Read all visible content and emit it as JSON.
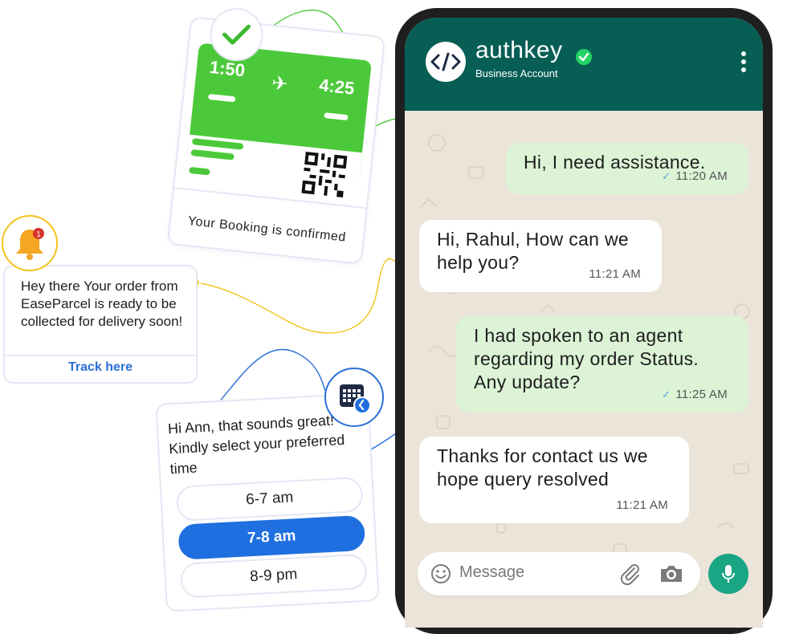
{
  "booking_card": {
    "departure_time": "1:50",
    "arrival_time": "4:25",
    "caption": "Your Booking is confirmed",
    "accent_color": "#4cc93a"
  },
  "notification_card": {
    "message": "Hey there Your order from EaseParcel is ready to be collected for delivery soon!",
    "link_label": "Track here",
    "badge_count": "1"
  },
  "picker_card": {
    "message": "Hi Ann, that sounds great! Kindly select your preferred time",
    "slots": [
      "6-7 am",
      "7-8 am",
      "8-9 pm"
    ],
    "selected_slot": "7-8 am",
    "accent_color": "#1f6fe0"
  },
  "chat": {
    "contact_name": "authkey",
    "contact_subtitle": "Business Account",
    "avatar_glyph": "</>",
    "header_color": "#075e54",
    "messages": [
      {
        "direction": "outgoing",
        "text": "Hi, I need assistance.",
        "time": "11:20 AM",
        "tick": "✓"
      },
      {
        "direction": "incoming",
        "text": "Hi, Rahul, How can we help you?",
        "time": "11:21 AM"
      },
      {
        "direction": "outgoing",
        "text": "I had spoken to an agent regarding my order Status. Any update?",
        "time": "11:25 AM",
        "tick": "✓"
      },
      {
        "direction": "incoming",
        "text": "Thanks for contact us we hope query resolved",
        "time": "11:21 AM"
      }
    ],
    "input_placeholder": "Message"
  },
  "icons": [
    "check-icon",
    "bell-icon",
    "calendar-clock-icon",
    "verified-icon",
    "more-vertical-icon",
    "emoji-icon",
    "paperclip-icon",
    "camera-icon",
    "microphone-icon",
    "airplane-icon",
    "qr-code-icon"
  ]
}
